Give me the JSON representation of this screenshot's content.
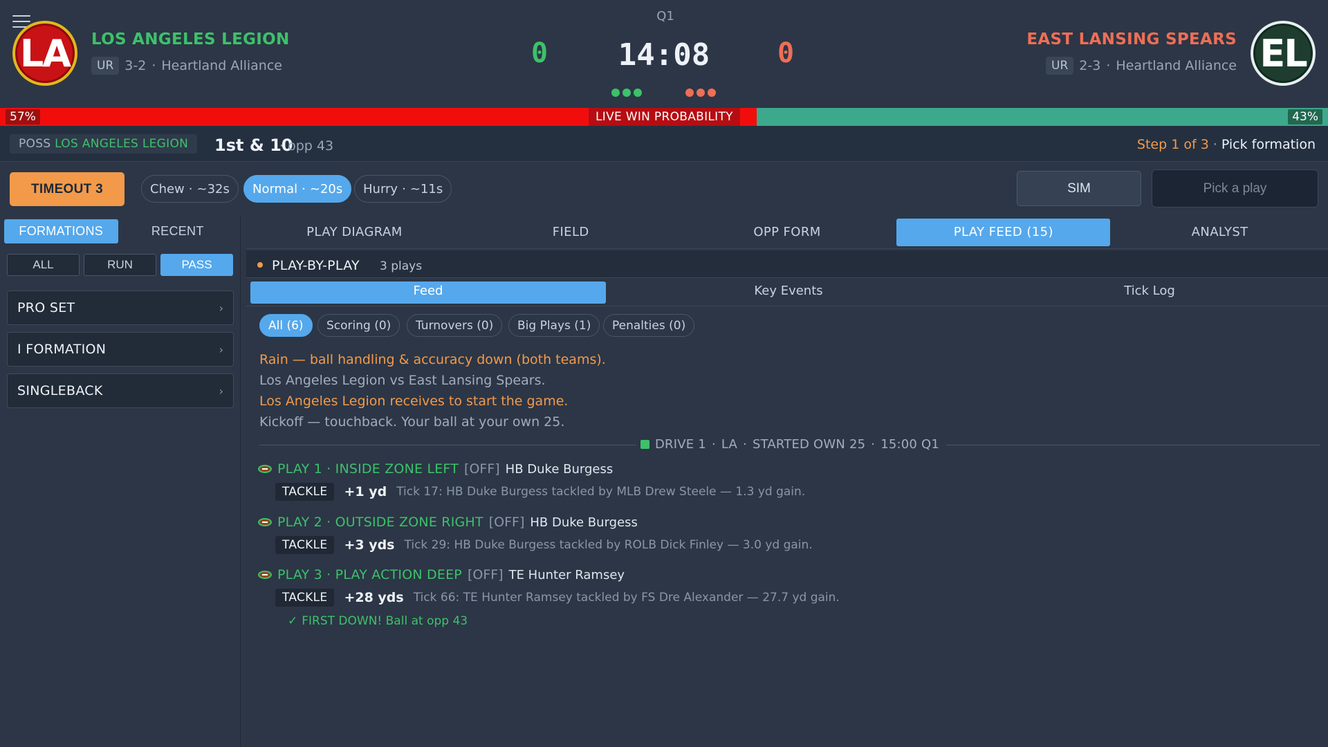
{
  "header": {
    "quarter": "Q1",
    "clock": "14:08",
    "home": {
      "logo": "LA",
      "name": "LOS ANGELES LEGION",
      "conf": "UR",
      "record": "3-2",
      "division": "Heartland Alliance",
      "score": "0",
      "color": "#3dc16a",
      "timeouts": 3
    },
    "away": {
      "logo": "EL",
      "name": "EAST LANSING SPEARS",
      "conf": "UR",
      "record": "2-3",
      "division": "Heartland Alliance",
      "score": "0",
      "color": "#ef6e55",
      "timeouts": 3
    }
  },
  "win_prob": {
    "label": "LIVE WIN PROBABILITY",
    "home_pct": "57%",
    "away_pct": "43%",
    "home_value": 0.57,
    "home_color": "#f20d0d",
    "away_color": "#3ca98c"
  },
  "possession": {
    "prefix": "POSS",
    "team": "LOS ANGELES LEGION",
    "down": "1st & 10",
    "spot": "· opp 43"
  },
  "step": {
    "progress": "Step 1 of 3",
    "sep": "·",
    "action": "Pick formation"
  },
  "controls": {
    "timeout": "TIMEOUT 3",
    "pace": [
      {
        "label": "Chew",
        "time": "~32s"
      },
      {
        "label": "Normal",
        "time": "~20s"
      },
      {
        "label": "Hurry",
        "time": "~11s"
      }
    ],
    "pace_selected": "Normal",
    "sim": "SIM",
    "pick_play": "Pick a play"
  },
  "sidebar": {
    "tabs": [
      "FORMATIONS",
      "RECENT"
    ],
    "filters": [
      "ALL",
      "RUN",
      "PASS"
    ],
    "filter_selected": "PASS",
    "formations": [
      "PRO SET",
      "I FORMATION",
      "SINGLEBACK"
    ]
  },
  "main_tabs": [
    "PLAY DIAGRAM",
    "FIELD",
    "OPP FORM",
    "PLAY FEED  (15)",
    "ANALYST"
  ],
  "main_tab_selected": "PLAY FEED  (15)",
  "pbp": {
    "title": "PLAY-BY-PLAY",
    "count": "3 plays"
  },
  "sub_tabs": [
    "Feed",
    "Key Events",
    "Tick Log"
  ],
  "chips": [
    "All (6)",
    "Scoring (0)",
    "Turnovers (0)",
    "Big Plays (1)",
    "Penalties (0)"
  ],
  "feed": [
    {
      "text": "Rain — ball handling & accuracy down (both teams).",
      "style": "orange"
    },
    {
      "text": "Los Angeles Legion vs East Lansing Spears.",
      "style": "grey"
    },
    {
      "text": "Los Angeles Legion receives to start the game.",
      "style": "orange"
    },
    {
      "text": "Kickoff — touchback. Your ball at your own 25.",
      "style": "grey"
    }
  ],
  "drive": {
    "label": "DRIVE 1",
    "team": "LA",
    "started": "STARTED OWN 25",
    "time": "15:00 Q1",
    "sep": "·"
  },
  "plays": [
    {
      "head": "PLAY 1 · INSIDE ZONE LEFT",
      "side": "[OFF]",
      "player": "HB Duke Burgess",
      "result": "TACKLE",
      "yds": "+1 yd",
      "tick": "Tick 17: HB Duke Burgess tackled by MLB Drew Steele — 1.3 yd gain."
    },
    {
      "head": "PLAY 2 · OUTSIDE ZONE RIGHT",
      "side": "[OFF]",
      "player": "HB Duke Burgess",
      "result": "TACKLE",
      "yds": "+3 yds",
      "tick": "Tick 29: HB Duke Burgess tackled by ROLB Dick Finley — 3.0 yd gain."
    },
    {
      "head": "PLAY 3 · PLAY ACTION DEEP",
      "side": "[OFF]",
      "player": "TE Hunter Ramsey",
      "result": "TACKLE",
      "yds": "+28 yds",
      "tick": "Tick 66: TE Hunter Ramsey tackled by FS Dre Alexander — 27.7 yd gain."
    }
  ],
  "first_down": {
    "mark": "✓",
    "text": "FIRST DOWN!  Ball at opp 43"
  },
  "icons": {
    "menu": "hamburger-icon",
    "chevron": "›",
    "ball": "football-icon",
    "check": "check-icon"
  }
}
